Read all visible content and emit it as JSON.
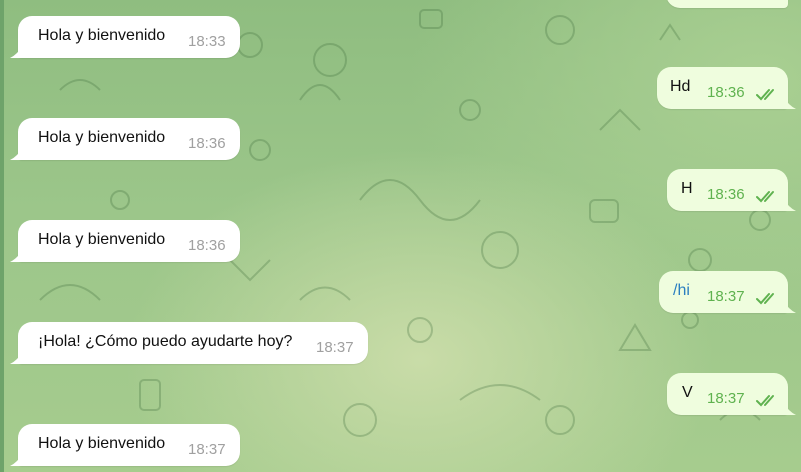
{
  "chat": {
    "incoming": [
      {
        "text": "Hola y bienvenido",
        "time": "18:33"
      },
      {
        "text": "Hola y bienvenido",
        "time": "18:36"
      },
      {
        "text": "Hola y bienvenido",
        "time": "18:36"
      },
      {
        "text": "¡Hola! ¿Cómo puedo ayudarte hoy?",
        "time": "18:37"
      },
      {
        "text": "Hola y bienvenido",
        "time": "18:37"
      }
    ],
    "outgoing": [
      {
        "text": "Hd",
        "time": "18:36",
        "status": "read"
      },
      {
        "text": "H",
        "time": "18:36",
        "status": "read"
      },
      {
        "text": "/hi",
        "time": "18:37",
        "status": "read"
      },
      {
        "text": "V",
        "time": "18:37",
        "status": "read"
      }
    ]
  },
  "colors": {
    "incoming_bubble": "#ffffff",
    "outgoing_bubble": "#effdde",
    "read_check": "#5fb24f",
    "command_link": "#2a7fc1"
  },
  "icons": {
    "read_status": "double-check-icon",
    "background": "doodle-pattern"
  }
}
